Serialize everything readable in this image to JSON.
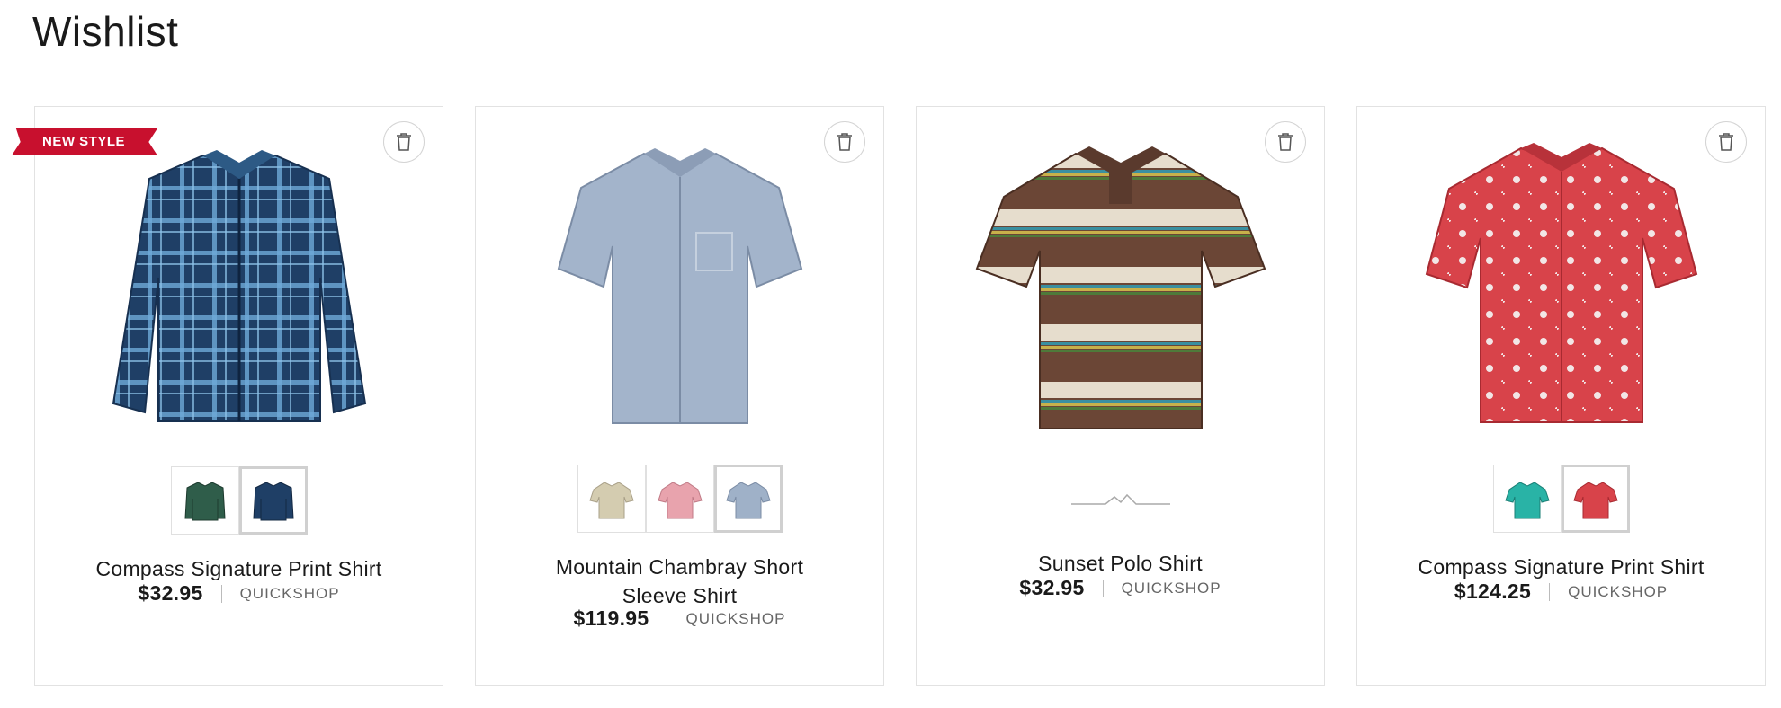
{
  "page": {
    "title": "Wishlist"
  },
  "products": [
    {
      "name": "Compass Signature Print Shirt",
      "price": "$32.95",
      "quickshop": "QUICKSHOP",
      "badge": "NEW STYLE"
    },
    {
      "name": "Mountain Chambray Short Sleeve Shirt",
      "price": "$119.95",
      "quickshop": "QUICKSHOP"
    },
    {
      "name": "Sunset Polo Shirt",
      "price": "$32.95",
      "quickshop": "QUICKSHOP"
    },
    {
      "name": "Compass Signature Print Shirt",
      "price": "$124.25",
      "quickshop": "QUICKSHOP"
    }
  ],
  "colors": {
    "badge": "#c8102e",
    "plaid_navy": "#1f3f66",
    "plaid_light": "#6ea9d8",
    "plaid_green": "#2f5d4a",
    "chambray": "#9fb1c8",
    "khaki": "#d4ccb0",
    "pink": "#e8a3ad",
    "polo_brown": "#6b4636",
    "polo_cream": "#e6ddcd",
    "teal": "#29b3a6",
    "red": "#d8434a"
  }
}
